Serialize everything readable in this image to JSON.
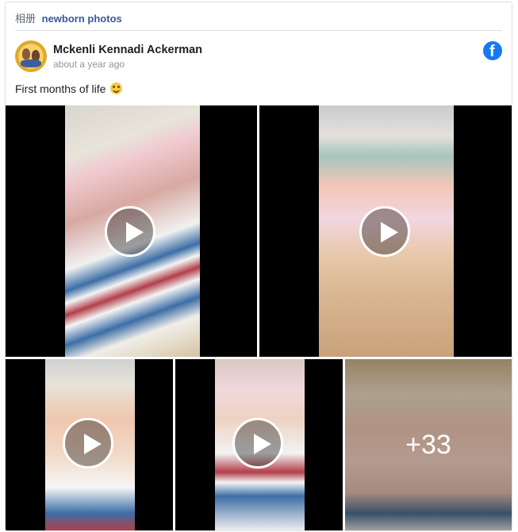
{
  "album": {
    "prefix": "相册",
    "name": "newborn photos"
  },
  "post": {
    "author": "Mckenli Kennadi Ackerman",
    "timestamp": "about a year ago",
    "caption": "First months of life",
    "caption_emoji": "smiling-face-emoji"
  },
  "media": [
    {
      "kind": "video",
      "icon": "play-icon"
    },
    {
      "kind": "video",
      "icon": "play-icon"
    },
    {
      "kind": "video",
      "icon": "play-icon"
    },
    {
      "kind": "video",
      "icon": "play-icon"
    },
    {
      "kind": "photo",
      "more_label": "+33"
    }
  ],
  "colors": {
    "brand": "#1877f2",
    "link": "#385898",
    "meta": "#90949c"
  }
}
